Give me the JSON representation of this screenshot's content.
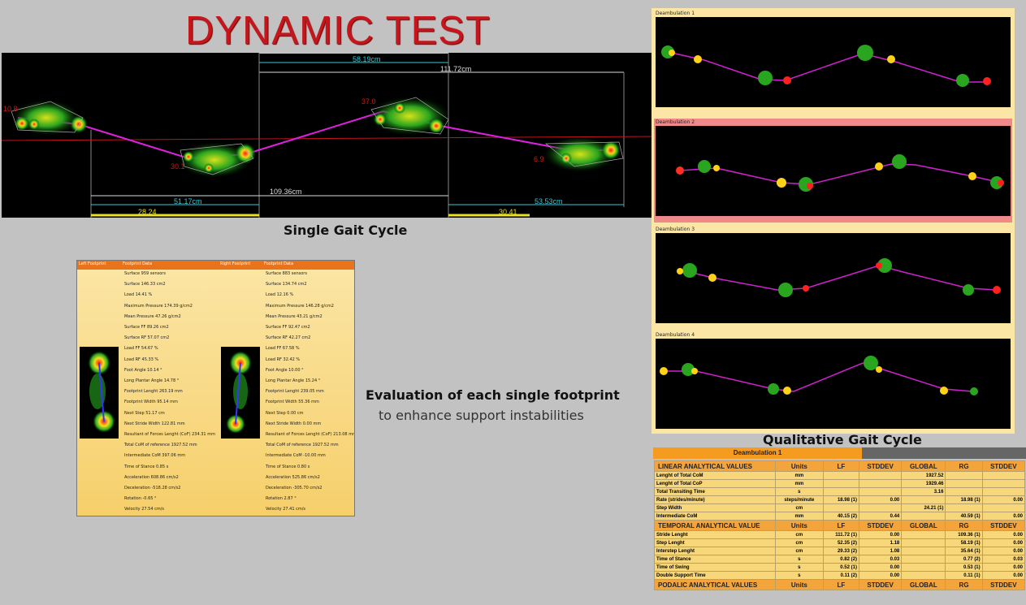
{
  "title": "DYNAMIC TEST",
  "single_gait": {
    "caption": "Single Gait Cycle",
    "measures": {
      "top_1": "58.19cm",
      "top_2": "111.72cm",
      "mid": "109.36cm",
      "left_bottom": "51.17cm",
      "right_bottom": "53.53cm",
      "left_yellow": "28.24",
      "right_yellow": "30.41"
    },
    "angles": [
      "10.8",
      "30.1",
      "37.0",
      "6.9"
    ]
  },
  "evaluation": {
    "line1": "Evaluation of each single footprint",
    "line2": "to enhance support instabilities"
  },
  "footprint": {
    "headers": {
      "left_fp": "Left Footprint",
      "left_data": "Footprint Data",
      "right_fp": "Right Footprint",
      "right_data": "Footprint Data"
    },
    "left": [
      "Surface 959 sensors",
      "Surface 146.33 cm2",
      "Load 14.41 %",
      "Maximum Pressure 174.39 g/cm2",
      "Mean Pressure 47.26 g/cm2",
      "Surface FF 89.26 cm2",
      "Surface RF 57.07 cm2",
      "Load FF 54.67 %",
      "Load RF 45.33 %",
      "Foot Angle 10.14 °",
      "Long Plantar Angle 14.78 °",
      "Footprint Lenght 263.19 mm",
      "Footprint Width 95.14 mm",
      "Next Step 51.17 cm",
      "Next Stride Width 122.81 mm",
      "Resultant of Forces Lenght (CoF) 234.31 mm",
      "Total CoM of reference 1927.52 mm",
      "Intermediate CoM 397.06 mm",
      "Time of Stance 0.85 s",
      "Acceleration 608.86 cm/s2",
      "Deceleration -518.28 cm/s2",
      "Rotation -0.65 °",
      "Velocity 27.54 cm/s"
    ],
    "right": [
      "Surface 883 sensors",
      "Surface 134.74 cm2",
      "Load 12.16 %",
      "Maximum Pressure 146.28 g/cm2",
      "Mean Pressure 43.21 g/cm2",
      "Surface FF 92.47 cm2",
      "Surface RF 42.27 cm2",
      "Load FF 67.58 %",
      "Load RF 32.42 %",
      "Foot Angle 10.00 °",
      "Long Plantar Angle 15.24 °",
      "Footprint Lenght 239.05 mm",
      "Footprint Width 55.36 mm",
      "Next Step 0.00 cm",
      "Next Stride Width 0.00 mm",
      "Resultant of Forces Lenght (CoF) 213.08 mm",
      "Total CoM of reference 1927.52 mm",
      "Intermediate CoM -10.00 mm",
      "Time of Stance 0.80 s",
      "Acceleration 525.86 cm/s2",
      "Deceleration -305.70 cm/s2",
      "Rotation 2.87 °",
      "Velocity 27.41 cm/s"
    ]
  },
  "qualitative": {
    "caption": "Qualitative Gait Cycle",
    "panels": [
      "Deambulation 1",
      "Deambulation 2",
      "Deambulation 3",
      "Deambulation 4"
    ]
  },
  "table": {
    "title": "Deambulation 1",
    "columns": [
      "Units",
      "LF",
      "STDDEV",
      "GLOBAL",
      "RG",
      "STDDEV"
    ],
    "sections": [
      {
        "name": "LINEAR ANALYTICAL VALUES",
        "rows": [
          [
            "Lenght of Total CoM",
            "mm",
            "",
            "",
            "1927.52",
            "",
            ""
          ],
          [
            "Lenght of Total CoP",
            "mm",
            "",
            "",
            "1929.46",
            "",
            ""
          ],
          [
            "Total Transiting Time",
            "s",
            "",
            "",
            "3.16",
            "",
            ""
          ],
          [
            "Rate (strides/minute)",
            "steps/minute",
            "18.98 (1)",
            "0.00",
            "",
            "18.98 (1)",
            "0.00"
          ],
          [
            "Step Width",
            "cm",
            "",
            "",
            "24.21 (1)",
            "",
            ""
          ],
          [
            "Intermediate CoM",
            "mm",
            "40.15 (2)",
            "0.44",
            "",
            "40.59 (1)",
            "0.00"
          ]
        ]
      },
      {
        "name": "TEMPORAL ANALYTICAL VALUE",
        "rows": [
          [
            "Stride Lenght",
            "cm",
            "111.72 (1)",
            "0.00",
            "",
            "109.36 (1)",
            "0.00"
          ],
          [
            "Step Lenght",
            "cm",
            "52.35 (2)",
            "1.18",
            "",
            "58.19 (1)",
            "0.00"
          ],
          [
            "Interstep Lenght",
            "cm",
            "29.33 (2)",
            "1.08",
            "",
            "35.64 (1)",
            "0.00"
          ],
          [
            "Time of Stance",
            "s",
            "0.82 (2)",
            "0.03",
            "",
            "0.77 (2)",
            "0.03"
          ],
          [
            "Time of Swing",
            "s",
            "0.52 (1)",
            "0.00",
            "",
            "0.53 (1)",
            "0.00"
          ],
          [
            "Double Support Time",
            "s",
            "0.11 (2)",
            "0.00",
            "",
            "0.11 (1)",
            "0.00"
          ]
        ]
      },
      {
        "name": "PODALIC ANALYTICAL VALUES",
        "rows": []
      }
    ]
  }
}
